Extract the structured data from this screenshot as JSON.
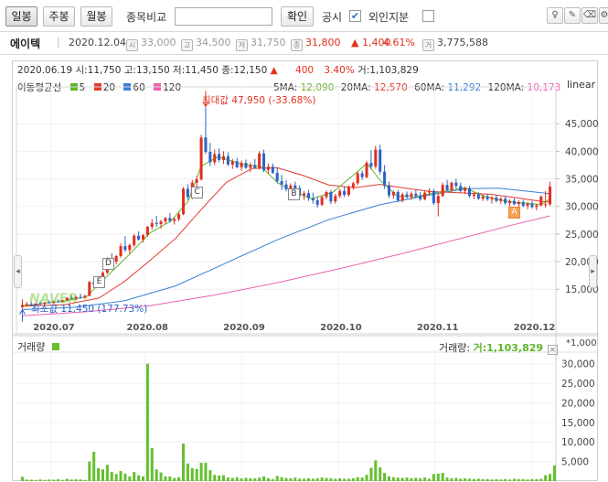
{
  "toolbar": {
    "tabs": [
      {
        "label": "일봉",
        "active": true
      },
      {
        "label": "주봉",
        "active": false
      },
      {
        "label": "월봉",
        "active": false
      }
    ],
    "compare_label": "종목비교",
    "compare_input_value": "",
    "confirm_label": "확인",
    "disclosure_label": "공시",
    "disclosure_checked": true,
    "foreign_label": "외인지분",
    "foreign_checked": false
  },
  "stock": {
    "name": "에이텍",
    "date": "2020.12.04",
    "open_icon": "시",
    "open": "33,000",
    "high_icon": "고",
    "high": "34,500",
    "low_icon": "저",
    "low": "31,750",
    "close_icon": "종",
    "close": "31,800",
    "change": "▲ 1,400",
    "change_pct": "4.61%",
    "volume_icon": "거",
    "volume": "3,775,588"
  },
  "ohlc_line": {
    "date": "2020.06.19",
    "open": "시:11,750",
    "high": "고:13,150",
    "low": "저:11,450",
    "close": "종:12,150",
    "arrow": "▲",
    "change": "400",
    "change_pct": "3.40%",
    "volume": "거:1,103,829"
  },
  "ma_legend": {
    "title": "이동평균선",
    "items": [
      {
        "label": "5",
        "color": "#5fb52c"
      },
      {
        "label": "20",
        "color": "#e23b2e"
      },
      {
        "label": "60",
        "color": "#3c7fd6"
      },
      {
        "label": "120",
        "color": "#ef5fb0"
      }
    ]
  },
  "ma_values": {
    "ma5_label": "5MA:",
    "ma5": "12,090",
    "ma20_label": "20MA:",
    "ma20": "12,570",
    "ma60_label": "60MA:",
    "ma60": "11,292",
    "ma120_label": "120MA:",
    "ma120": "10,173"
  },
  "scale_mode": "linear",
  "annotations": {
    "max_label": "최대값 47,950 (-33.68%)",
    "min_label": "최소값 11,450 (177.73%)",
    "watermark": "NAVER"
  },
  "markers": [
    {
      "label": "A",
      "style": "orange"
    },
    {
      "label": "B",
      "style": "plain"
    },
    {
      "label": "C",
      "style": "plain"
    },
    {
      "label": "D",
      "style": "plain"
    },
    {
      "label": "E",
      "style": "plain"
    }
  ],
  "colors": {
    "up": "#e0301e",
    "down": "#2c64c8",
    "volume": "#65c02f",
    "change_up": "#e0301e"
  },
  "chart_data": [
    {
      "type": "candlestick",
      "title": "에이텍",
      "y_ticks": [
        "45,000",
        "40,000",
        "35,000",
        "30,000",
        "25,000",
        "20,000",
        "15,000"
      ],
      "y_tick_values": [
        45000,
        40000,
        35000,
        30000,
        25000,
        20000,
        15000
      ],
      "ylim": [
        9400,
        51000
      ],
      "x_tick_labels": [
        "2020.07",
        "2020.08",
        "2020.09",
        "2020.10",
        "2020.11",
        "2020.12"
      ],
      "x_tick_days": [
        9,
        38,
        68,
        98,
        128,
        158
      ],
      "series_ohlc": [
        [
          11750,
          13150,
          11450,
          12150
        ],
        [
          12200,
          12700,
          11900,
          12300
        ],
        [
          12300,
          12700,
          12000,
          12100
        ],
        [
          12100,
          12500,
          11950,
          12400
        ],
        [
          12400,
          12800,
          12150,
          12350
        ],
        [
          12350,
          12700,
          12100,
          12600
        ],
        [
          12600,
          13000,
          12400,
          12500
        ],
        [
          12500,
          12900,
          12300,
          12800
        ],
        [
          12800,
          13200,
          12600,
          12700
        ],
        [
          12700,
          13100,
          12500,
          13000
        ],
        [
          13000,
          13600,
          12800,
          13400
        ],
        [
          13400,
          13900,
          13100,
          13300
        ],
        [
          13300,
          13800,
          13000,
          13600
        ],
        [
          13600,
          14200,
          13300,
          13500
        ],
        [
          13500,
          14000,
          13200,
          13800
        ],
        [
          13800,
          16500,
          13700,
          16300
        ],
        [
          16300,
          17300,
          15600,
          15900
        ],
        [
          15900,
          16800,
          15500,
          16400
        ],
        [
          16400,
          18300,
          16200,
          18000
        ],
        [
          18000,
          20800,
          17700,
          20300
        ],
        [
          20300,
          21500,
          19600,
          20000
        ],
        [
          20000,
          21200,
          19500,
          21000
        ],
        [
          21000,
          23300,
          20700,
          22800
        ],
        [
          22800,
          24600,
          21800,
          22100
        ],
        [
          22100,
          23300,
          21400,
          23000
        ],
        [
          23000,
          25000,
          22600,
          24700
        ],
        [
          24700,
          25500,
          23800,
          24000
        ],
        [
          24000,
          25000,
          23500,
          24800
        ],
        [
          24800,
          26500,
          24500,
          26300
        ],
        [
          26300,
          27700,
          25800,
          27000
        ],
        [
          27000,
          28300,
          26300,
          26800
        ],
        [
          26800,
          27600,
          26000,
          27300
        ],
        [
          27300,
          28100,
          26800,
          27900
        ],
        [
          27900,
          28800,
          27100,
          27400
        ],
        [
          27400,
          28000,
          26700,
          27700
        ],
        [
          27700,
          29000,
          27300,
          28600
        ],
        [
          28600,
          33500,
          28400,
          33200
        ],
        [
          33200,
          34000,
          31200,
          31700
        ],
        [
          31700,
          34800,
          31300,
          34300
        ],
        [
          34300,
          35500,
          33500,
          34900
        ],
        [
          34900,
          43000,
          34700,
          42500
        ],
        [
          42500,
          47950,
          39500,
          39900
        ],
        [
          39900,
          41500,
          37300,
          38000
        ],
        [
          38000,
          40300,
          37500,
          39500
        ],
        [
          39500,
          40500,
          38000,
          38400
        ],
        [
          38400,
          40000,
          37700,
          39100
        ],
        [
          39100,
          39800,
          37300,
          37600
        ],
        [
          37600,
          38600,
          36800,
          38200
        ],
        [
          38200,
          38800,
          36900,
          37100
        ],
        [
          37100,
          38300,
          36500,
          37900
        ],
        [
          37900,
          38500,
          36800,
          37000
        ],
        [
          37000,
          38000,
          36200,
          37500
        ],
        [
          37500,
          38600,
          36800,
          37000
        ],
        [
          37000,
          40000,
          36700,
          39600
        ],
        [
          39600,
          40300,
          36200,
          36600
        ],
        [
          36600,
          37800,
          35900,
          37200
        ],
        [
          37200,
          37800,
          35900,
          36100
        ],
        [
          36100,
          37000,
          34200,
          34600
        ],
        [
          34600,
          35700,
          33000,
          34000
        ],
        [
          34000,
          34800,
          32700,
          33100
        ],
        [
          33100,
          34200,
          32600,
          33800
        ],
        [
          33800,
          34500,
          33000,
          33300
        ],
        [
          33300,
          33800,
          31500,
          32000
        ],
        [
          32000,
          32800,
          31200,
          32400
        ],
        [
          32400,
          33000,
          31000,
          31500
        ],
        [
          31500,
          32500,
          30500,
          31100
        ],
        [
          31100,
          31800,
          29800,
          30300
        ],
        [
          30300,
          31900,
          30100,
          31700
        ],
        [
          31700,
          32900,
          31300,
          32600
        ],
        [
          32600,
          33000,
          30400,
          30900
        ],
        [
          30900,
          32300,
          30500,
          31900
        ],
        [
          31900,
          33200,
          31500,
          32800
        ],
        [
          32800,
          33600,
          31700,
          32100
        ],
        [
          32100,
          33800,
          31800,
          33500
        ],
        [
          33500,
          34500,
          33000,
          34200
        ],
        [
          34200,
          36300,
          33900,
          36000
        ],
        [
          36000,
          36500,
          34800,
          35300
        ],
        [
          35300,
          38300,
          35100,
          37900
        ],
        [
          37900,
          40200,
          36700,
          37200
        ],
        [
          37200,
          41000,
          36800,
          40300
        ],
        [
          40300,
          41200,
          35800,
          36300
        ],
        [
          36300,
          37500,
          33200,
          33800
        ],
        [
          33800,
          34500,
          31500,
          32000
        ],
        [
          32000,
          32900,
          31400,
          32600
        ],
        [
          32600,
          33000,
          30800,
          31100
        ],
        [
          31100,
          32500,
          30700,
          32200
        ],
        [
          32200,
          32700,
          31400,
          31700
        ],
        [
          31700,
          32700,
          31200,
          32300
        ],
        [
          32300,
          33000,
          31600,
          31900
        ],
        [
          31900,
          32600,
          31000,
          31300
        ],
        [
          31300,
          32800,
          31100,
          32500
        ],
        [
          32500,
          33300,
          32000,
          32800
        ],
        [
          32800,
          33200,
          30300,
          30600
        ],
        [
          30600,
          32500,
          28200,
          31900
        ],
        [
          31900,
          34300,
          31700,
          33900
        ],
        [
          33900,
          34800,
          32700,
          33000
        ],
        [
          33000,
          34500,
          32600,
          34300
        ],
        [
          34300,
          35000,
          33300,
          33700
        ],
        [
          33700,
          34300,
          32500,
          32800
        ],
        [
          32800,
          33600,
          32200,
          33300
        ],
        [
          33300,
          33700,
          31600,
          31900
        ],
        [
          31900,
          32600,
          31300,
          32200
        ],
        [
          32200,
          32600,
          31200,
          31400
        ],
        [
          31400,
          32200,
          31000,
          31800
        ],
        [
          31800,
          32300,
          31000,
          31300
        ],
        [
          31300,
          31900,
          30500,
          31600
        ],
        [
          31600,
          32000,
          30700,
          31000
        ],
        [
          31000,
          31700,
          30500,
          31400
        ],
        [
          31400,
          31800,
          30300,
          30600
        ],
        [
          30600,
          31300,
          30000,
          31000
        ],
        [
          31000,
          31500,
          30200,
          30400
        ],
        [
          30400,
          31100,
          29700,
          30800
        ],
        [
          30800,
          31200,
          29900,
          30100
        ],
        [
          30100,
          30800,
          29500,
          30500
        ],
        [
          30500,
          31000,
          29600,
          29900
        ],
        [
          29900,
          30500,
          29300,
          30200
        ],
        [
          30200,
          32000,
          30000,
          31800
        ],
        [
          30400,
          32800,
          29800,
          30400
        ],
        [
          30400,
          34500,
          30100,
          33600
        ]
      ],
      "ma": {
        "ma5": [
          [
            0,
            12000
          ],
          [
            10,
            12900
          ],
          [
            15,
            13600
          ],
          [
            20,
            17400
          ],
          [
            25,
            21200
          ],
          [
            30,
            25200
          ],
          [
            35,
            27400
          ],
          [
            39,
            31000
          ],
          [
            42,
            37300
          ],
          [
            46,
            39000
          ],
          [
            52,
            37600
          ],
          [
            56,
            37300
          ],
          [
            60,
            34300
          ],
          [
            64,
            32600
          ],
          [
            68,
            31400
          ],
          [
            73,
            32600
          ],
          [
            78,
            35800
          ],
          [
            81,
            37800
          ],
          [
            84,
            34800
          ],
          [
            88,
            31900
          ],
          [
            92,
            31700
          ],
          [
            96,
            32300
          ],
          [
            100,
            32900
          ],
          [
            104,
            33400
          ],
          [
            108,
            32000
          ],
          [
            112,
            31200
          ],
          [
            116,
            30700
          ],
          [
            120,
            30500
          ],
          [
            122,
            30300
          ],
          [
            124,
            31400
          ]
        ],
        "ma20": [
          [
            0,
            11900
          ],
          [
            10,
            12200
          ],
          [
            18,
            13400
          ],
          [
            24,
            16400
          ],
          [
            30,
            20200
          ],
          [
            36,
            24200
          ],
          [
            42,
            29400
          ],
          [
            48,
            34400
          ],
          [
            54,
            36900
          ],
          [
            60,
            37000
          ],
          [
            66,
            35600
          ],
          [
            72,
            33900
          ],
          [
            78,
            33400
          ],
          [
            84,
            34000
          ],
          [
            90,
            33300
          ],
          [
            96,
            32700
          ],
          [
            102,
            32500
          ],
          [
            110,
            32200
          ],
          [
            116,
            31600
          ],
          [
            122,
            30900
          ],
          [
            124,
            30800
          ]
        ],
        "ma60": [
          [
            0,
            11300
          ],
          [
            12,
            11700
          ],
          [
            24,
            12900
          ],
          [
            36,
            15600
          ],
          [
            48,
            19800
          ],
          [
            60,
            24000
          ],
          [
            72,
            27600
          ],
          [
            84,
            30300
          ],
          [
            96,
            32100
          ],
          [
            104,
            33200
          ],
          [
            112,
            33300
          ],
          [
            118,
            32800
          ],
          [
            124,
            32300
          ]
        ],
        "ma120": [
          [
            0,
            10200
          ],
          [
            15,
            10900
          ],
          [
            30,
            12000
          ],
          [
            45,
            13900
          ],
          [
            60,
            16200
          ],
          [
            75,
            18800
          ],
          [
            90,
            21600
          ],
          [
            105,
            24600
          ],
          [
            115,
            26600
          ],
          [
            124,
            28300
          ]
        ]
      }
    },
    {
      "type": "bar",
      "title": "거래량",
      "unit": "*1,000",
      "y_ticks": [
        "30,000",
        "25,000",
        "20,000",
        "15,000",
        "10,000",
        "5,000"
      ],
      "y_tick_values": [
        30000,
        25000,
        20000,
        15000,
        10000,
        5000
      ],
      "ylim": [
        0,
        32500
      ],
      "values": [
        1100,
        400,
        350,
        300,
        400,
        300,
        400,
        350,
        450,
        300,
        600,
        400,
        450,
        400,
        300,
        5000,
        7500,
        3300,
        3000,
        4200,
        2300,
        1800,
        2600,
        1900,
        1200,
        2300,
        1500,
        1200,
        30000,
        8400,
        3000,
        2200,
        1200,
        1200,
        800,
        1000,
        9600,
        4500,
        3300,
        3100,
        4700,
        4700,
        2800,
        1600,
        1400,
        1500,
        900,
        800,
        1000,
        700,
        800,
        700,
        700,
        900,
        1200,
        700,
        500,
        1300,
        1000,
        800,
        700,
        900,
        600,
        600,
        700,
        600,
        700,
        900,
        800,
        700,
        600,
        700,
        600,
        600,
        700,
        1000,
        900,
        1600,
        3400,
        5300,
        3500,
        2100,
        1200,
        1000,
        900,
        800,
        900,
        700,
        800,
        700,
        900,
        600,
        1800,
        1900,
        2100,
        900,
        700,
        800,
        600,
        700,
        600,
        500,
        600,
        500,
        500,
        400,
        500,
        400,
        500,
        400,
        600,
        500,
        500,
        400,
        500,
        500,
        600,
        1500,
        1800,
        4000
      ]
    }
  ]
}
